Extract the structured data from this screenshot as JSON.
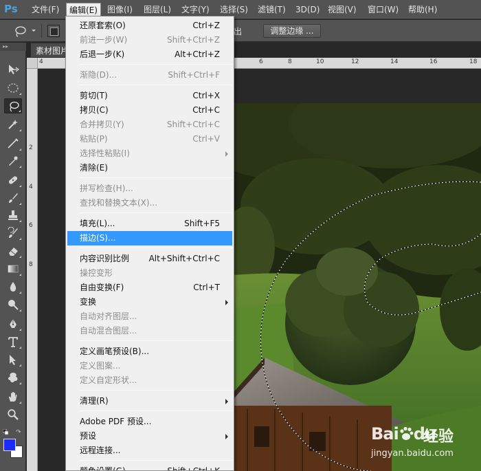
{
  "app": {
    "logo": "Ps"
  },
  "menubar": {
    "items": [
      {
        "label": "文件(F)",
        "active": false
      },
      {
        "label": "编辑(E)",
        "active": true
      },
      {
        "label": "图像(I)",
        "active": false
      },
      {
        "label": "图层(L)",
        "active": false
      },
      {
        "label": "文字(Y)",
        "active": false
      },
      {
        "label": "选择(S)",
        "active": false
      },
      {
        "label": "滤镜(T)",
        "active": false
      },
      {
        "label": "3D(D)",
        "active": false
      },
      {
        "label": "视图(V)",
        "active": false
      },
      {
        "label": "窗口(W)",
        "active": false
      },
      {
        "label": "帮助(H)",
        "active": false
      }
    ]
  },
  "options_bar": {
    "partial_label": "出",
    "refine_edge_label": "调整边缘 ..."
  },
  "document": {
    "tab_label": "素材图片",
    "ruler_top_ticks": [
      "4",
      "6",
      "8",
      "10",
      "12",
      "14",
      "16",
      "18"
    ],
    "ruler_left_ticks": [
      "2",
      "4",
      "6",
      "8"
    ]
  },
  "edit_menu": {
    "items": [
      {
        "label": "还原套索(O)",
        "shortcut": "Ctrl+Z",
        "disabled": false
      },
      {
        "label": "前进一步(W)",
        "shortcut": "Shift+Ctrl+Z",
        "disabled": true
      },
      {
        "label": "后退一步(K)",
        "shortcut": "Alt+Ctrl+Z",
        "disabled": false
      },
      {
        "label": "渐隐(D)...",
        "shortcut": "Shift+Ctrl+F",
        "disabled": true
      },
      {
        "label": "剪切(T)",
        "shortcut": "Ctrl+X",
        "disabled": false
      },
      {
        "label": "拷贝(C)",
        "shortcut": "Ctrl+C",
        "disabled": false
      },
      {
        "label": "合并拷贝(Y)",
        "shortcut": "Shift+Ctrl+C",
        "disabled": true
      },
      {
        "label": "粘贴(P)",
        "shortcut": "Ctrl+V",
        "disabled": true
      },
      {
        "label": "选择性粘贴(I)",
        "shortcut": "",
        "disabled": true,
        "submenu": true
      },
      {
        "label": "清除(E)",
        "shortcut": "",
        "disabled": false
      },
      {
        "label": "拼写检查(H)...",
        "shortcut": "",
        "disabled": true
      },
      {
        "label": "查找和替换文本(X)...",
        "shortcut": "",
        "disabled": true
      },
      {
        "label": "填充(L)...",
        "shortcut": "Shift+F5",
        "disabled": false
      },
      {
        "label": "描边(S)...",
        "shortcut": "",
        "disabled": false,
        "highlighted": true
      },
      {
        "label": "内容识别比例",
        "shortcut": "Alt+Shift+Ctrl+C",
        "disabled": false
      },
      {
        "label": "操控变形",
        "shortcut": "",
        "disabled": true
      },
      {
        "label": "自由变换(F)",
        "shortcut": "Ctrl+T",
        "disabled": false
      },
      {
        "label": "变换",
        "shortcut": "",
        "disabled": false,
        "submenu": true
      },
      {
        "label": "自动对齐图层...",
        "shortcut": "",
        "disabled": true
      },
      {
        "label": "自动混合图层...",
        "shortcut": "",
        "disabled": true
      },
      {
        "label": "定义画笔预设(B)...",
        "shortcut": "",
        "disabled": false
      },
      {
        "label": "定义图案...",
        "shortcut": "",
        "disabled": true
      },
      {
        "label": "定义自定形状...",
        "shortcut": "",
        "disabled": true
      },
      {
        "label": "清理(R)",
        "shortcut": "",
        "disabled": false,
        "submenu": true
      },
      {
        "label": "Adobe PDF 预设...",
        "shortcut": "",
        "disabled": false
      },
      {
        "label": "预设",
        "shortcut": "",
        "disabled": false,
        "submenu": true
      },
      {
        "label": "远程连接...",
        "shortcut": "",
        "disabled": false
      },
      {
        "label": "颜色设置(G)...",
        "shortcut": "Shift+Ctrl+K",
        "disabled": false
      }
    ]
  },
  "colors": {
    "foreground": "#1a2cff",
    "background": "#ffffff",
    "menu_highlight": "#3399ff"
  },
  "tools": [
    "move-tool-icon",
    "marquee-tool-icon",
    "lasso-tool-icon",
    "magic-wand-tool-icon",
    "crop-tool-icon",
    "eyedropper-tool-icon",
    "healing-brush-tool-icon",
    "brush-tool-icon",
    "clone-stamp-tool-icon",
    "history-brush-tool-icon",
    "eraser-tool-icon",
    "gradient-tool-icon",
    "blur-tool-icon",
    "dodge-tool-icon",
    "pen-tool-icon",
    "type-tool-icon",
    "path-selection-tool-icon",
    "shape-tool-icon",
    "hand-tool-icon",
    "zoom-tool-icon"
  ],
  "watermark": {
    "brand": "Bai",
    "brand2": "du",
    "jingyan": "经验",
    "url": "jingyan.baidu.com"
  }
}
